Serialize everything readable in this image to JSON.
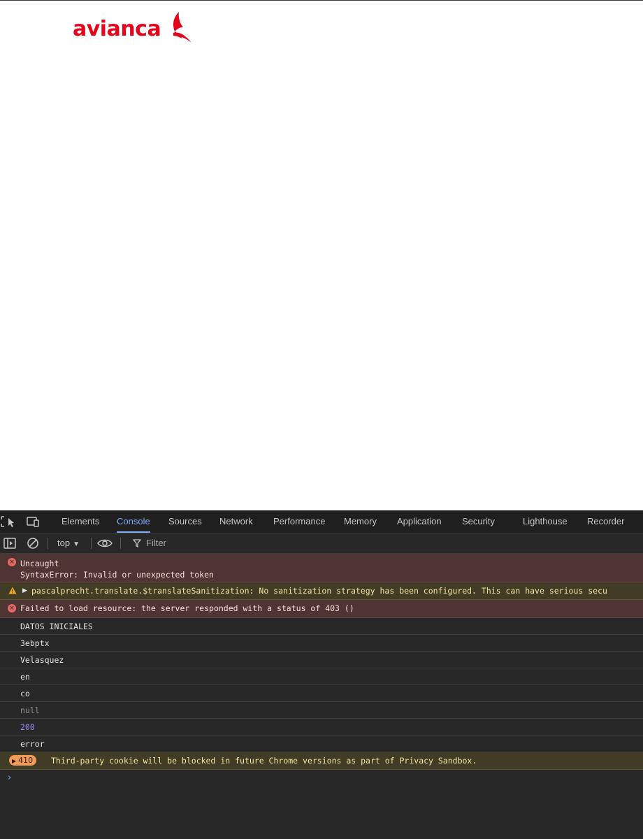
{
  "page": {
    "logo_text": "avianca",
    "brand_color": "#e3051b"
  },
  "devtools": {
    "tabs": [
      "Elements",
      "Console",
      "Sources",
      "Network",
      "Performance",
      "Memory",
      "Application",
      "Security",
      "Lighthouse",
      "Recorder"
    ],
    "active_tab": "Console",
    "accent_color": "#7cacf8",
    "toolbar": {
      "context": "top",
      "filter_placeholder": "Filter"
    },
    "messages": [
      {
        "level": "error",
        "lines": [
          "Uncaught",
          "SyntaxError: Invalid or unexpected token"
        ]
      },
      {
        "level": "warning",
        "text": "pascalprecht.translate.$translateSanitization: No sanitization strategy has been configured. This can have serious secu"
      },
      {
        "level": "error",
        "text": "Failed to load resource: the server responded with a status of 403 ()"
      },
      {
        "level": "log",
        "text": "DATOS INICIALES"
      },
      {
        "level": "log",
        "text": "3ebptx"
      },
      {
        "level": "log",
        "text": "Velasquez"
      },
      {
        "level": "log",
        "text": "en"
      },
      {
        "level": "log",
        "text": "co"
      },
      {
        "level": "log-null",
        "text": "null"
      },
      {
        "level": "log-number",
        "text": "200"
      },
      {
        "level": "log",
        "text": "error"
      },
      {
        "level": "cookie-issue",
        "count": "410",
        "text": "Third-party cookie will be blocked in future Chrome versions as part of Privacy Sandbox."
      }
    ],
    "icons": [
      "inspect-element-icon",
      "device-toolbar-icon",
      "sidebar-toggle-icon",
      "clear-console-icon",
      "eye-icon",
      "filter-icon",
      "error-icon",
      "warning-icon",
      "expand-triangle-icon",
      "prompt-chevron-icon"
    ]
  }
}
